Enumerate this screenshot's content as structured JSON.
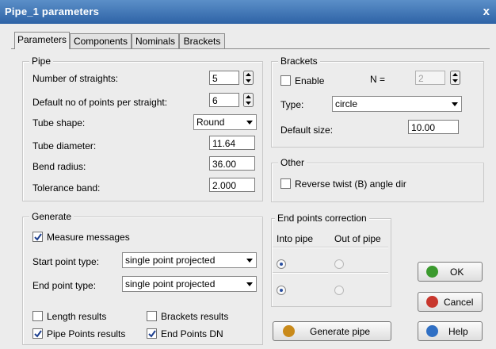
{
  "window": {
    "title": "Pipe_1 parameters",
    "close_glyph": "x"
  },
  "tabs": [
    {
      "label": "Parameters"
    },
    {
      "label": "Components"
    },
    {
      "label": "Nominals"
    },
    {
      "label": "Brackets"
    }
  ],
  "pipe": {
    "title": "Pipe",
    "num_straights": {
      "label": "Number of straights:",
      "value": "5"
    },
    "default_points": {
      "label": "Default no of points per straight:",
      "value": "6"
    },
    "tube_shape": {
      "label": "Tube shape:",
      "value": "Round"
    },
    "tube_diameter": {
      "label": "Tube diameter:",
      "value": "11.64"
    },
    "bend_radius": {
      "label": "Bend radius:",
      "value": "36.00"
    },
    "tolerance_band": {
      "label": "Tolerance band:",
      "value": "2.000"
    }
  },
  "brackets": {
    "title": "Brackets",
    "enable_label": "Enable",
    "enable_checked": false,
    "n_label": "N =",
    "n_value": "2",
    "type_label": "Type:",
    "type_value": "circle",
    "default_size_label": "Default size:",
    "default_size_value": "10.00"
  },
  "other": {
    "title": "Other",
    "reverse_twist_label": "Reverse twist (B) angle dir",
    "reverse_twist_checked": false
  },
  "generate": {
    "title": "Generate",
    "measure_messages_label": "Measure messages",
    "measure_messages_checked": true,
    "start_point_label": "Start point type:",
    "start_point_value": "single point projected",
    "end_point_label": "End point type:",
    "end_point_value": "single point projected",
    "length_results_label": "Length results",
    "length_results_checked": false,
    "brackets_results_label": "Brackets results",
    "brackets_results_checked": false,
    "pipe_points_label": "Pipe Points results",
    "pipe_points_checked": true,
    "end_points_dn_label": "End Points DN",
    "end_points_dn_checked": true
  },
  "end_points_correction": {
    "title": "End points correction",
    "col_into": "Into pipe",
    "col_out": "Out of pipe",
    "start_selected": "into",
    "end_selected": "into"
  },
  "buttons": {
    "generate_pipe": "Generate pipe",
    "ok": "OK",
    "cancel": "Cancel",
    "help": "Help"
  },
  "colors": {
    "titlebar": "#2e63a6",
    "ok_icon": "#3b9a2e",
    "cancel_icon": "#c8372d",
    "help_icon": "#2f6fc4",
    "generate_icon": "#c98a1a"
  }
}
